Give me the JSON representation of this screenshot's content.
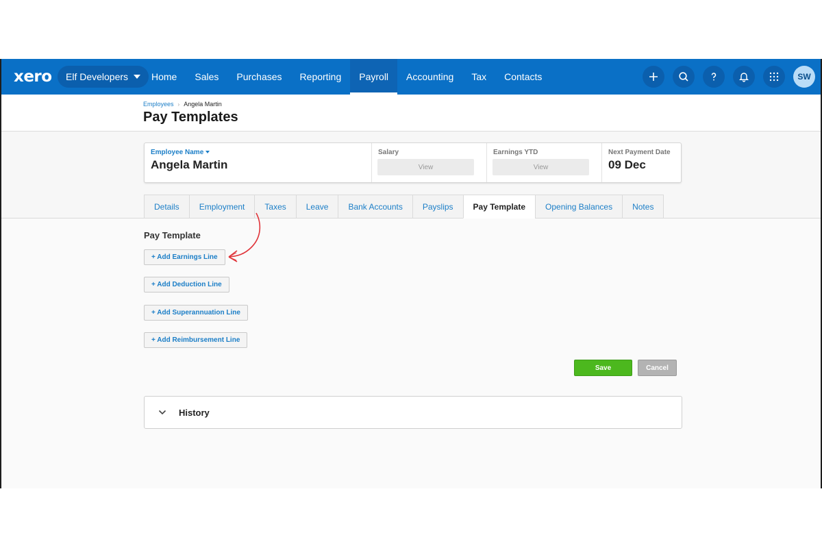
{
  "topnav": {
    "logo": "xero",
    "org_name": "Elf Developers",
    "links": [
      {
        "label": "Home"
      },
      {
        "label": "Sales"
      },
      {
        "label": "Purchases"
      },
      {
        "label": "Reporting"
      },
      {
        "label": "Payroll",
        "active": true
      },
      {
        "label": "Accounting"
      },
      {
        "label": "Tax"
      },
      {
        "label": "Contacts"
      }
    ],
    "icons": [
      "plus-icon",
      "search-icon",
      "help-icon",
      "bell-icon",
      "apps-grid-icon"
    ],
    "avatar_initials": "SW"
  },
  "breadcrumb": {
    "parent": "Employees",
    "current": "Angela Martin"
  },
  "page_title": "Pay Templates",
  "employee_card": {
    "name_label": "Employee Name",
    "name": "Angela Martin",
    "salary_label": "Salary",
    "salary_action": "View",
    "earnings_label": "Earnings YTD",
    "earnings_action": "View",
    "next_payment_label": "Next Payment Date",
    "next_payment_value": "09 Dec"
  },
  "tabs": [
    {
      "label": "Details"
    },
    {
      "label": "Employment"
    },
    {
      "label": "Taxes"
    },
    {
      "label": "Leave"
    },
    {
      "label": "Bank Accounts"
    },
    {
      "label": "Payslips"
    },
    {
      "label": "Pay Template",
      "active": true
    },
    {
      "label": "Opening Balances"
    },
    {
      "label": "Notes"
    }
  ],
  "pay_template": {
    "title": "Pay Template",
    "add_earnings": "+ Add Earnings Line",
    "add_deduction": "+ Add Deduction Line",
    "add_superannuation": "+ Add Superannuation Line",
    "add_reimbursement": "+ Add Reimbursement Line"
  },
  "actions": {
    "save": "Save",
    "cancel": "Cancel"
  },
  "history": {
    "title": "History"
  },
  "colors": {
    "nav_blue": "#0a70c6",
    "link_blue": "#1b7ec7",
    "save_green": "#4cb81e",
    "annotation_red": "#e0343a"
  }
}
